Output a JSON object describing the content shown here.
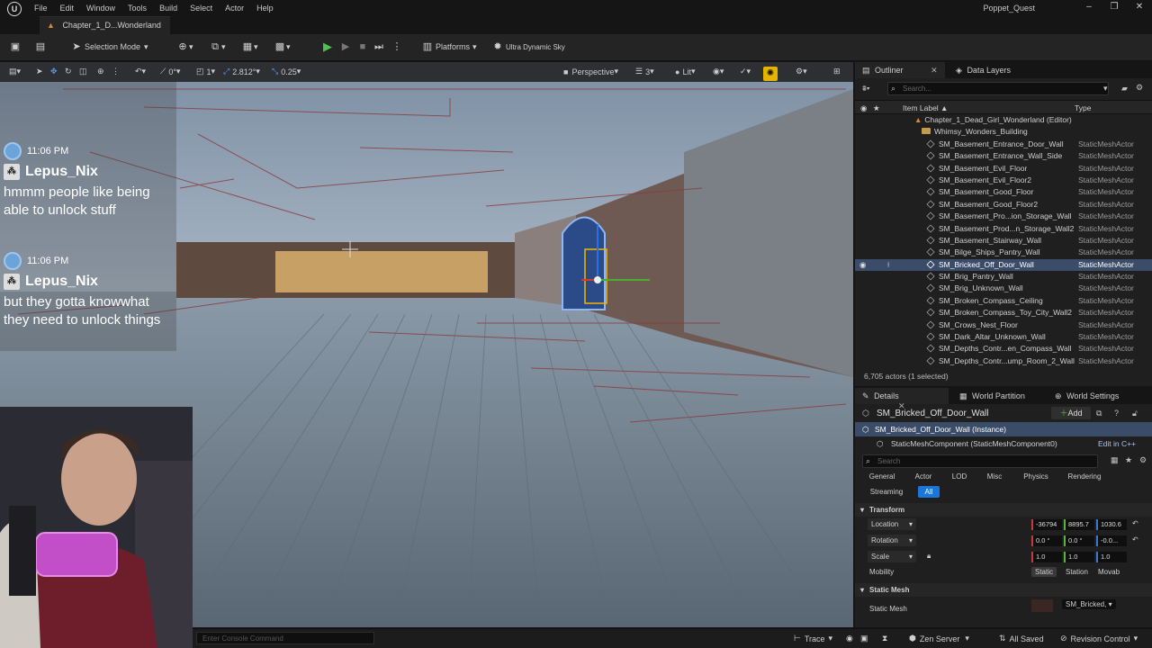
{
  "menubar": {
    "items": [
      "File",
      "Edit",
      "Window",
      "Tools",
      "Build",
      "Select",
      "Actor",
      "Help"
    ],
    "project": "Poppet_Quest"
  },
  "tab": {
    "title": "Chapter_1_D...Wonderland"
  },
  "toolbar": {
    "mode": "Selection Mode",
    "platforms": "Platforms",
    "sky": "Ultra Dynamic Sky"
  },
  "viewport_toolbar": {
    "rotation_snap": "0°",
    "scale_snap_count": "1",
    "scale": "2.812°",
    "camera_speed": "0.25",
    "view": "Perspective",
    "fov_count": "3",
    "lit": "Lit"
  },
  "chat": {
    "messages": [
      {
        "time": "11:06 PM",
        "user": "Lepus_Nix",
        "text": "hmmm people like being able to unlock stuff"
      },
      {
        "time": "11:06 PM",
        "user": "Lepus_Nix",
        "text": "but they gotta knowwhat they need to unlock things"
      }
    ]
  },
  "statusbar": {
    "console_placeholder": "Enter Console Command",
    "trace": "Trace",
    "zen": "Zen Server",
    "saved": "All Saved",
    "revision": "Revision Control"
  },
  "outliner": {
    "tab": "Outliner",
    "tab2": "Data Layers",
    "search_placeholder": "Search...",
    "col_label": "Item Label ▲",
    "col_type": "Type",
    "level": "Chapter_1_Dead_Girl_Wonderland (Editor)",
    "folder": "Whimsy_Wonders_Building",
    "rows": [
      {
        "label": "SM_Basement_Entrance_Door_Wall",
        "type": "StaticMeshActor"
      },
      {
        "label": "SM_Basement_Entrance_Wall_Side",
        "type": "StaticMeshActor"
      },
      {
        "label": "SM_Basement_Evil_Floor",
        "type": "StaticMeshActor"
      },
      {
        "label": "SM_Basement_Evil_Floor2",
        "type": "StaticMeshActor"
      },
      {
        "label": "SM_Basement_Good_Floor",
        "type": "StaticMeshActor"
      },
      {
        "label": "SM_Basement_Good_Floor2",
        "type": "StaticMeshActor"
      },
      {
        "label": "SM_Basement_Pro...ion_Storage_Wall",
        "type": "StaticMeshActor"
      },
      {
        "label": "SM_Basement_Prod...n_Storage_Wall2",
        "type": "StaticMeshActor"
      },
      {
        "label": "SM_Basement_Stairway_Wall",
        "type": "StaticMeshActor"
      },
      {
        "label": "SM_Bilge_Ships_Pantry_Wall",
        "type": "StaticMeshActor"
      },
      {
        "label": "SM_Bricked_Off_Door_Wall",
        "type": "StaticMeshActor"
      },
      {
        "label": "SM_Brig_Pantry_Wall",
        "type": "StaticMeshActor"
      },
      {
        "label": "SM_Brig_Unknown_Wall",
        "type": "StaticMeshActor"
      },
      {
        "label": "SM_Broken_Compass_Ceiling",
        "type": "StaticMeshActor"
      },
      {
        "label": "SM_Broken_Compass_Toy_City_Wall2",
        "type": "StaticMeshActor"
      },
      {
        "label": "SM_Crows_Nest_Floor",
        "type": "StaticMeshActor"
      },
      {
        "label": "SM_Dark_Altar_Unknown_Wall",
        "type": "StaticMeshActor"
      },
      {
        "label": "SM_Depths_Contr...en_Compass_Wall",
        "type": "StaticMeshActor"
      },
      {
        "label": "SM_Depths_Contr...ump_Room_2_Wall",
        "type": "StaticMeshActor"
      }
    ],
    "count": "6,705 actors (1 selected)"
  },
  "details": {
    "tab": "Details",
    "tab2": "World Partition",
    "tab3": "World Settings",
    "name": "SM_Bricked_Off_Door_Wall",
    "add": "Add",
    "instance": "SM_Bricked_Off_Door_Wall (Instance)",
    "component": "StaticMeshComponent (StaticMeshComponent0)",
    "edit_cpp": "Edit in C++",
    "search_placeholder": "Search",
    "filters": [
      "General",
      "Actor",
      "LOD",
      "Misc",
      "Physics",
      "Rendering",
      "Streaming",
      "All"
    ],
    "transform": "Transform",
    "location_label": "Location",
    "location": [
      "-36794",
      "8895.7",
      "1030.6"
    ],
    "rotation_label": "Rotation",
    "rotation": [
      "0.0 °",
      "0.0 °",
      "-0.0..."
    ],
    "scale_label": "Scale",
    "scale": [
      "1.0",
      "1.0",
      "1.0"
    ],
    "mobility_label": "Mobility",
    "mobility": [
      "Static",
      "Station",
      "Movab"
    ],
    "static_mesh_section": "Static Mesh",
    "static_mesh_label": "Static Mesh",
    "static_mesh_value": "SM_Bricked,"
  }
}
